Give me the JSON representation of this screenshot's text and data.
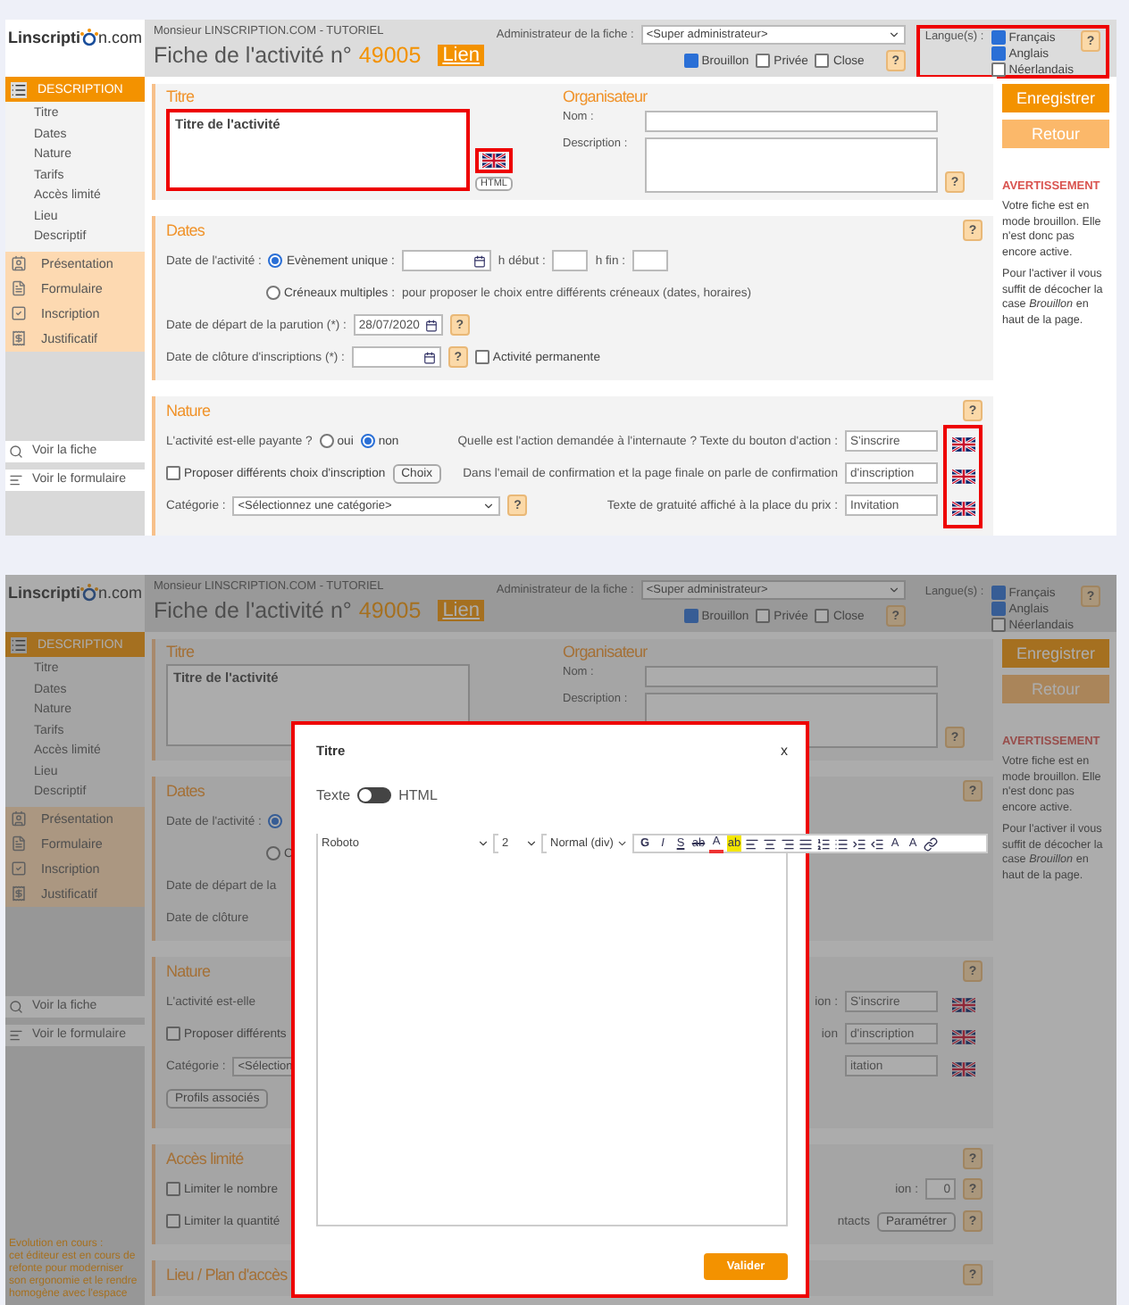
{
  "screens": [
    {
      "header": {
        "logo_left": "Linscripti",
        "logo_right": "n.com",
        "user": "Monsieur LINSCRIPTION.COM - TUTORIEL",
        "title": "Fiche de l'activité n°",
        "number": "49005",
        "link": "Lien",
        "admin_label": "Administrateur de la fiche :",
        "admin_value": "<Super administrateur>",
        "states": [
          {
            "label": "Brouillon",
            "checked": true
          },
          {
            "label": "Privée",
            "checked": false
          },
          {
            "label": "Close",
            "checked": false
          }
        ],
        "states_help": "?",
        "languages_label": "Langue(s) :",
        "languages": [
          {
            "label": "Français",
            "checked": true
          },
          {
            "label": "Anglais",
            "checked": true
          },
          {
            "label": "Néerlandais",
            "checked": false
          }
        ],
        "languages_help": "?",
        "languages_highlighted": true
      },
      "sidebar": {
        "section": "DESCRIPTION",
        "items": [
          "Titre",
          "Dates",
          "Nature",
          "Tarifs",
          "Accès limité",
          "Lieu",
          "Descriptif"
        ],
        "modules": [
          {
            "kind": "presentation",
            "label": "Présentation"
          },
          {
            "kind": "form",
            "label": "Formulaire"
          },
          {
            "kind": "registration",
            "label": "Inscription"
          },
          {
            "kind": "receipt",
            "label": "Justificatif"
          }
        ],
        "links": [
          {
            "kind": "search",
            "label": "Voir la fiche"
          },
          {
            "kind": "form",
            "label": "Voir le formulaire"
          }
        ]
      },
      "title_block": {
        "title": "Titre",
        "value": "Titre de l'activité",
        "highlighted": true,
        "flag": true,
        "flag_highlighted": true,
        "html": "HTML"
      },
      "organizer": {
        "title": "Organisateur",
        "name_label": "Nom :",
        "description_label": "Description :",
        "help": "?"
      },
      "sections": [
        {
          "title": "Dates",
          "help": "?",
          "rows": [
            {
              "left": [
                {
                  "kind": "label",
                  "text": "Date de l'activité :"
                },
                {
                  "kind": "radio",
                  "label": "Evènement unique :",
                  "selected": true
                },
                {
                  "kind": "date-field"
                },
                {
                  "kind": "label",
                  "text": "h début :"
                },
                {
                  "kind": "time-field"
                },
                {
                  "kind": "label",
                  "text": "h fin :"
                },
                {
                  "kind": "time-field"
                }
              ]
            },
            {
              "left": [
                {
                  "kind": "radio",
                  "label": "Créneaux multiples :",
                  "selected": false
                },
                {
                  "kind": "note",
                  "text": "pour proposer le choix entre différents créneaux (dates, horaires)"
                }
              ]
            },
            {
              "left": [
                {
                  "kind": "label",
                  "text": "Date de départ de la parution (*) :"
                },
                {
                  "kind": "date-field",
                  "value": "28/07/2020"
                },
                {
                  "kind": "help",
                  "text": "?"
                }
              ]
            },
            {
              "left": [
                {
                  "kind": "label",
                  "text": "Date de clôture d'inscriptions (*) :"
                },
                {
                  "kind": "date-field"
                },
                {
                  "kind": "help",
                  "text": "?"
                },
                {
                  "kind": "checkbox",
                  "label": "Activité permanente",
                  "checked": false
                }
              ]
            }
          ]
        },
        {
          "title": "Nature",
          "help": "?",
          "flags_highlighted": true,
          "rows": [
            {
              "left": [
                {
                  "kind": "label",
                  "text": "L'activité est-elle payante ?"
                },
                {
                  "kind": "radio",
                  "label": "oui",
                  "selected": false
                },
                {
                  "kind": "radio",
                  "label": "non",
                  "selected": true
                }
              ],
              "right": [
                {
                  "kind": "label",
                  "text": "Quelle est l'action demandée à l'internaute ? Texte du bouton d'action :"
                },
                {
                  "kind": "field",
                  "value": "S'inscrire"
                }
              ],
              "flag": true
            },
            {
              "left": [
                {
                  "kind": "checkbox",
                  "label": "Proposer différents choix d'inscription",
                  "checked": false
                },
                {
                  "kind": "button",
                  "label": "Choix"
                }
              ],
              "right": [
                {
                  "kind": "label",
                  "text": "Dans l'email de confirmation et la page finale on parle de confirmation"
                },
                {
                  "kind": "field",
                  "value": "d'inscription"
                }
              ],
              "flag": true
            },
            {
              "left": [
                {
                  "kind": "label",
                  "text": "Catégorie :"
                },
                {
                  "kind": "select",
                  "value": "<Sélectionnez une catégorie>"
                },
                {
                  "kind": "help",
                  "text": "?"
                }
              ],
              "right": [
                {
                  "kind": "label",
                  "text": "Texte de gratuité affiché à la place du prix :"
                },
                {
                  "kind": "field",
                  "value": "Invitation"
                }
              ],
              "flag": true
            }
          ]
        }
      ],
      "aside": {
        "save": "Enregistrer",
        "back": "Retour",
        "warning_title": "AVERTISSEMENT",
        "warning": [
          "Votre fiche est en mode brouillon. Elle n'est donc pas encore active.",
          "Pour l'activer il vous suffit de décocher la case *Brouillon* en haut de la page."
        ]
      }
    },
    {
      "header": {
        "logo_left": "Linscripti",
        "logo_right": "n.com",
        "user": "Monsieur LINSCRIPTION.COM - TUTORIEL",
        "title": "Fiche de l'activité n°",
        "number": "49005",
        "link": "Lien",
        "admin_label": "Administrateur de la fiche :",
        "admin_value": "<Super administrateur>",
        "states": [
          {
            "label": "Brouillon",
            "checked": true
          },
          {
            "label": "Privée",
            "checked": false
          },
          {
            "label": "Close",
            "checked": false
          }
        ],
        "states_help": "?",
        "languages_label": "Langue(s) :",
        "languages": [
          {
            "label": "Français",
            "checked": true
          },
          {
            "label": "Anglais",
            "checked": true
          },
          {
            "label": "Néerlandais",
            "checked": false
          }
        ],
        "languages_help": "?"
      },
      "sidebar": {
        "section": "DESCRIPTION",
        "items": [
          "Titre",
          "Dates",
          "Nature",
          "Tarifs",
          "Accès limité",
          "Lieu",
          "Descriptif"
        ],
        "modules": [
          {
            "kind": "presentation",
            "label": "Présentation"
          },
          {
            "kind": "form",
            "label": "Formulaire"
          },
          {
            "kind": "registration",
            "label": "Inscription"
          },
          {
            "kind": "receipt",
            "label": "Justificatif"
          }
        ],
        "links": [
          {
            "kind": "search",
            "label": "Voir la fiche"
          },
          {
            "kind": "form",
            "label": "Voir le formulaire"
          }
        ],
        "note_title": "Evolution en cours :",
        "note": "cet éditeur est en cours de refonte pour moderniser son ergonomie et le rendre homogène avec l'espace"
      },
      "title_block": {
        "title": "Titre",
        "value": "Titre de l'activité",
        "highlighted": false
      },
      "organizer": {
        "title": "Organisateur",
        "name_label": "Nom :",
        "description_label": "Description :",
        "help": "?"
      },
      "sections": [
        {
          "title": "Dates",
          "help": "?",
          "rows": [
            {
              "left": [
                {
                  "kind": "label",
                  "text": "Date de l'activité :"
                },
                {
                  "kind": "radio",
                  "selected": true
                }
              ]
            },
            {
              "left": [
                {
                  "kind": "radio",
                  "label": "C",
                  "selected": false
                }
              ]
            },
            {
              "left": [
                {
                  "kind": "label",
                  "text": "Date de départ de la"
                }
              ]
            },
            {
              "left": [
                {
                  "kind": "label",
                  "text": "Date de clôture"
                }
              ]
            }
          ]
        },
        {
          "title": "Nature",
          "help": "?",
          "rows": [
            {
              "left": [
                {
                  "kind": "label",
                  "text": "L'activité est-elle"
                }
              ],
              "right": [
                {
                  "kind": "label",
                  "text": "ion :"
                },
                {
                  "kind": "field",
                  "value": "S'inscrire"
                }
              ],
              "flag": true
            },
            {
              "left": [
                {
                  "kind": "checkbox",
                  "label": "Proposer différents",
                  "checked": false
                }
              ],
              "right": [
                {
                  "kind": "label",
                  "text": "ion"
                },
                {
                  "kind": "field",
                  "value": "d'inscription"
                }
              ],
              "flag": true
            },
            {
              "left": [
                {
                  "kind": "label",
                  "text": "Catégorie :"
                },
                {
                  "kind": "select-fragment",
                  "value": "<Sélection"
                }
              ],
              "right": [
                {
                  "kind": "field",
                  "value": "itation"
                }
              ],
              "flag": true
            },
            {
              "left": [
                {
                  "kind": "button",
                  "label": "Profils associés"
                }
              ]
            }
          ]
        },
        {
          "title": "Accès limité",
          "help": "?",
          "rows": [
            {
              "left": [
                {
                  "kind": "checkbox",
                  "label": "Limiter le nombre",
                  "checked": false
                }
              ],
              "right": [
                {
                  "kind": "label",
                  "text": "ion :"
                },
                {
                  "kind": "number-field",
                  "value": "0"
                },
                {
                  "kind": "help",
                  "text": "?"
                }
              ]
            },
            {
              "left": [
                {
                  "kind": "checkbox",
                  "label": "Limiter la quantité",
                  "checked": false
                }
              ],
              "right": [
                {
                  "kind": "label",
                  "text": "ntacts"
                },
                {
                  "kind": "button",
                  "label": "Paramétrer"
                },
                {
                  "kind": "help",
                  "text": "?"
                }
              ]
            }
          ]
        },
        {
          "title": "Lieu / Plan d'accès",
          "help": "?"
        }
      ],
      "aside": {
        "save": "Enregistrer",
        "back": "Retour",
        "warning_title": "AVERTISSEMENT",
        "warning": [
          "Votre fiche est en mode brouillon. Elle n'est donc pas encore active.",
          "Pour l'activer il vous suffit de décocher la case *Brouillon* en haut de la page."
        ]
      },
      "modal": {
        "title": "Titre",
        "close": "x",
        "toggle_left": "Texte",
        "toggle_right": "HTML",
        "html_on": false,
        "font": "Roboto",
        "size": "2",
        "format": "Normal (div)",
        "submit": "Valider",
        "highlighted": true,
        "tools": [
          {
            "kind": "bold",
            "label": "G"
          },
          {
            "kind": "italic",
            "label": "I"
          },
          {
            "kind": "underline",
            "label": "S"
          },
          {
            "kind": "strike",
            "label": "ab"
          },
          {
            "kind": "color",
            "label": "A"
          },
          {
            "kind": "highlight",
            "label": "ab"
          },
          {
            "kind": "align-left"
          },
          {
            "kind": "align-center"
          },
          {
            "kind": "align-right"
          },
          {
            "kind": "justify"
          },
          {
            "kind": "ordered-list"
          },
          {
            "kind": "bullet-list"
          },
          {
            "kind": "indent"
          },
          {
            "kind": "outdent"
          },
          {
            "kind": "superscript",
            "label": "A"
          },
          {
            "kind": "subscript",
            "label": "A"
          },
          {
            "kind": "link"
          }
        ]
      }
    }
  ]
}
